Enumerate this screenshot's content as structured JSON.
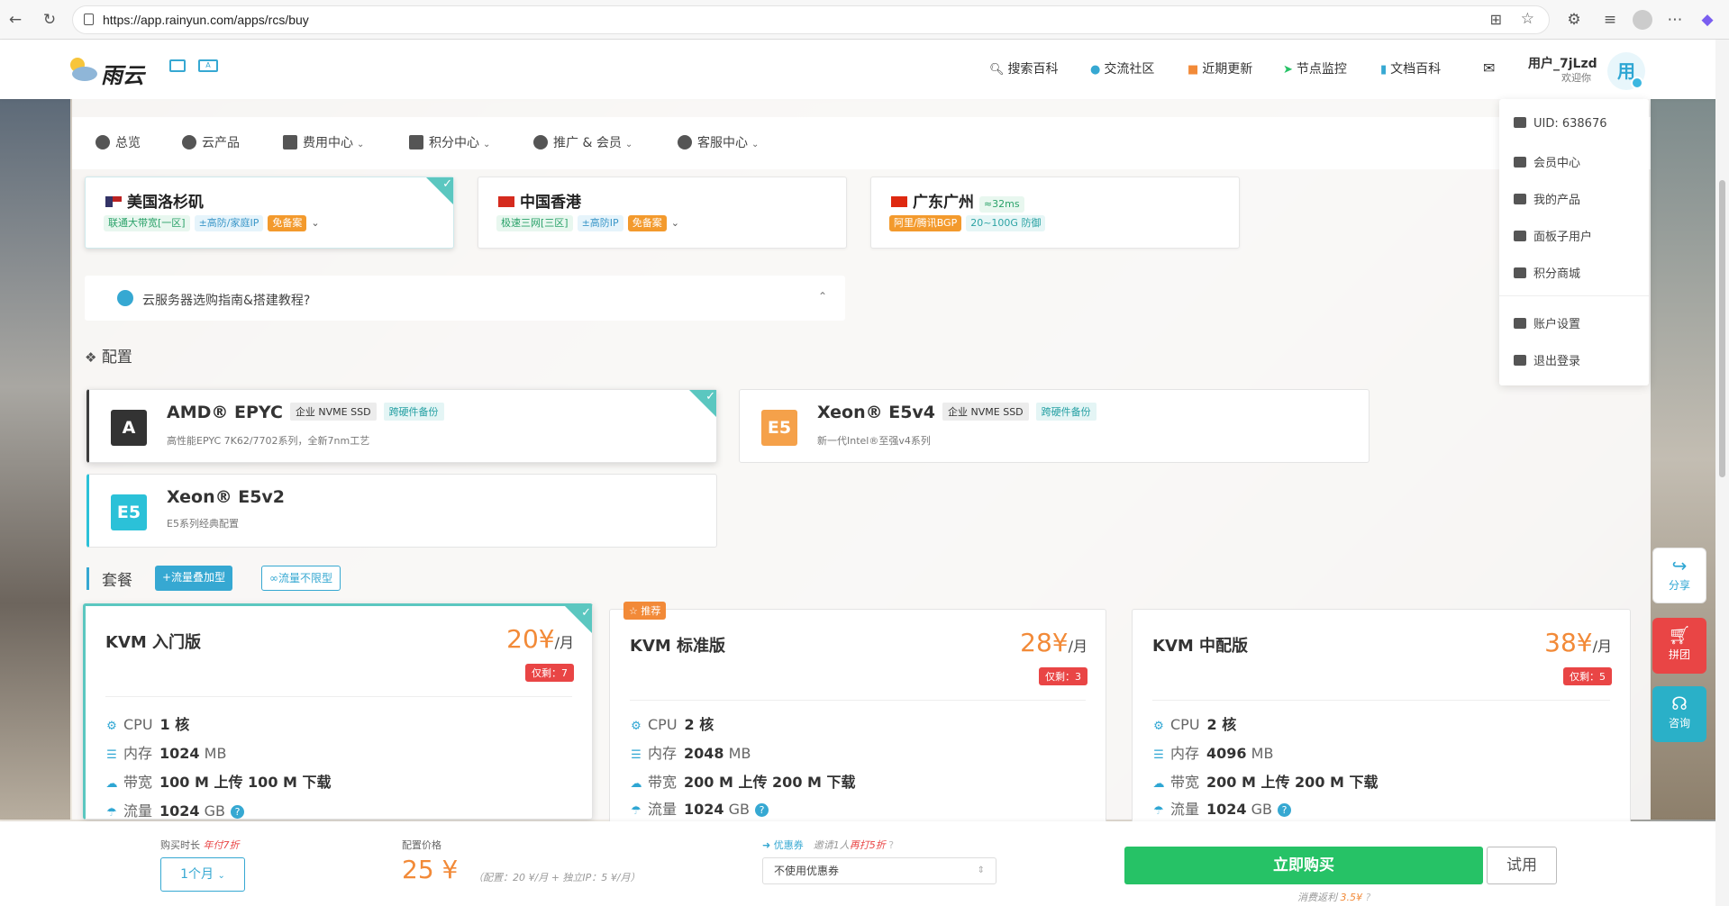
{
  "browser": {
    "url": "https://app.rainyun.com/apps/rcs/buy"
  },
  "header": {
    "logo_text": "雨云",
    "nav": [
      {
        "label": "搜索百科",
        "icon": "search-icon"
      },
      {
        "label": "交流社区",
        "icon": "community-icon"
      },
      {
        "label": "近期更新",
        "icon": "updates-icon"
      },
      {
        "label": "节点监控",
        "icon": "monitor-icon"
      },
      {
        "label": "文档百科",
        "icon": "docs-icon"
      }
    ],
    "username": "用户_7jLzd",
    "welcome": "欢迎你",
    "avatar_text": "用"
  },
  "subnav": [
    {
      "label": "总览"
    },
    {
      "label": "云产品"
    },
    {
      "label": "费用中心"
    },
    {
      "label": "积分中心"
    },
    {
      "label": "推广 & 会员"
    },
    {
      "label": "客服中心"
    }
  ],
  "regions": [
    {
      "name": "美国洛杉矶",
      "tags": [
        "联通大带宽[一区]",
        "±高防/家庭IP",
        "免备案"
      ],
      "selected": true
    },
    {
      "name": "中国香港",
      "tags": [
        "极速三网[三区]",
        "±高防IP",
        "免备案"
      ],
      "selected": false
    },
    {
      "name": "广东广州",
      "latency": "≈32ms",
      "tags": [
        "阿里/腾讯BGP",
        "20~100G 防御"
      ],
      "selected": false
    }
  ],
  "guide": {
    "text": "云服务器选购指南&搭建教程?"
  },
  "config": {
    "title": "配置",
    "items": [
      {
        "icon_text": "A",
        "name": "AMD® EPYC",
        "tags": [
          "企业 NVME SSD",
          "跨硬件备份"
        ],
        "desc": "高性能EPYC 7K62/7702系列，全新7nm工艺",
        "selected": true,
        "color": "#333333"
      },
      {
        "icon_text": "E5",
        "name": "Xeon® E5v4",
        "tags": [
          "企业 NVME SSD",
          "跨硬件备份"
        ],
        "desc": "新一代Intel®至强v4系列",
        "selected": false,
        "color": "#f5a14a"
      },
      {
        "icon_text": "E5",
        "name": "Xeon® E5v2",
        "tags": [],
        "desc": "E5系列经典配置",
        "selected": false,
        "color": "#2bc1d8"
      }
    ]
  },
  "plans": {
    "title": "套餐",
    "filters": [
      "+流量叠加型",
      "∞流量不限型"
    ],
    "recommend_badge": "☆ 推荐",
    "items": [
      {
        "name": "KVM 入门版",
        "price": "20¥",
        "unit": "/月",
        "stock": "仅剩：7",
        "cpu": "1 核",
        "mem_val": "1024",
        "mem_unit": "MB",
        "bw": "100 M 上传 100 M 下载",
        "traffic_val": "1024",
        "traffic_unit": "GB",
        "selected": true
      },
      {
        "name": "KVM 标准版",
        "price": "28¥",
        "unit": "/月",
        "stock": "仅剩：3",
        "cpu": "2 核",
        "mem_val": "2048",
        "mem_unit": "MB",
        "bw": "200 M 上传 200 M 下载",
        "traffic_val": "1024",
        "traffic_unit": "GB",
        "selected": false
      },
      {
        "name": "KVM 中配版",
        "price": "38¥",
        "unit": "/月",
        "stock": "仅剩：5",
        "cpu": "2 核",
        "mem_val": "4096",
        "mem_unit": "MB",
        "bw": "200 M 上传 200 M 下载",
        "traffic_val": "1024",
        "traffic_unit": "GB",
        "selected": false
      }
    ],
    "labels": {
      "cpu": "CPU",
      "mem": "内存",
      "bw": "带宽",
      "traffic": "流量"
    }
  },
  "user_menu": {
    "uid": "UID: 638676",
    "items": [
      "会员中心",
      "我的产品",
      "面板子用户",
      "积分商城"
    ],
    "items2": [
      "账户设置",
      "退出登录"
    ]
  },
  "side_buttons": [
    {
      "label": "分享",
      "icon": "share-icon"
    },
    {
      "label": "拼团",
      "icon": "cart-icon"
    },
    {
      "label": "咨询",
      "icon": "headset-icon"
    }
  ],
  "bottom": {
    "duration_label": "购买时长",
    "duration_promo": "年付7折",
    "duration_value": "1个月",
    "price_label": "配置价格",
    "price": "25 ¥",
    "price_note": "（配置：20 ¥/月 + 独立IP：5 ¥/月）",
    "coupon_label": "优惠券",
    "coupon_hint": "邀请1人",
    "coupon_promo": "再打5折",
    "coupon_value": "不使用优惠券",
    "buy_label": "立即购买",
    "trial_label": "试用",
    "rebate_label": "消费返利",
    "rebate_value": "3.5¥"
  },
  "colors": {
    "accent": "#36a8d2",
    "buy": "#26c266",
    "price": "#f28a38",
    "stock": "#e94545"
  }
}
